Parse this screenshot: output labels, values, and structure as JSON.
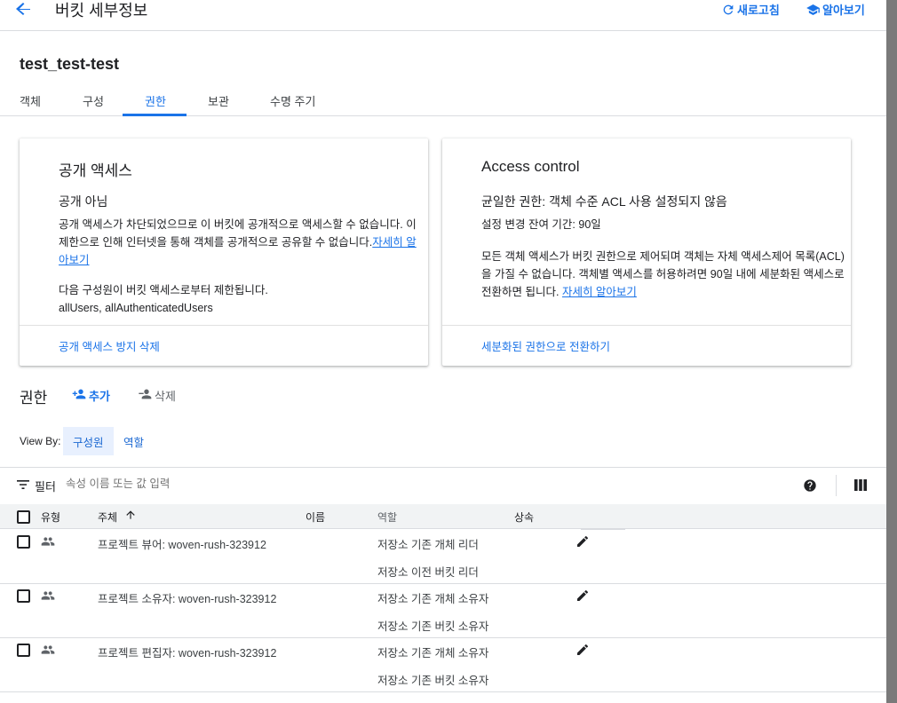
{
  "header": {
    "title": "버킷 세부정보",
    "refresh_label": "새로고침",
    "learn_label": "알아보기"
  },
  "bucket": {
    "name": "test_test-test"
  },
  "tabs": [
    {
      "label": "객체"
    },
    {
      "label": "구성"
    },
    {
      "label": "권한",
      "active": true
    },
    {
      "label": "보관"
    },
    {
      "label": "수명 주기"
    }
  ],
  "public_access_card": {
    "title": "공개 액세스",
    "status": "공개 아님",
    "description_part1": "공개 액세스가 차단되었으므로 이 버킷에 공개적으로 액세스할 수 없습니다. 이",
    "description_part2": "제한으로 인해 인터넷을 통해 객체를 공개적으로 공유할 수 없습니다.",
    "learn_more_part1": "자세히 알",
    "learn_more_part2": "아보기",
    "restricted_label": "다음 구성원이 버킷 액세스로부터 제한됩니다.",
    "restricted_members": "allUsers, allAuthenticatedUsers",
    "action": "공개 액세스 방지 삭제"
  },
  "access_control_card": {
    "title": "Access control",
    "status": "균일한 권한: 객체 수준 ACL 사용 설정되지 않음",
    "remaining": "설정 변경 잔여 기간: 90일",
    "description_line1": "모든 객체 액세스가 버킷 권한으로 제어되며 객체는 자체 액세스제어 목록(ACL)",
    "description_line2": "을 가질 수 없습니다. 객체별 액세스를 허용하려면 90일 내에 세분화된 액세스로",
    "description_line3": "전환하면 됩니다.",
    "learn_more": "자세히 알아보기",
    "action": "세분화된 권한으로 전환하기"
  },
  "permissions": {
    "title": "권한",
    "add_label": "추가",
    "delete_label": "삭제",
    "view_by_label": "View By:",
    "view_by_options": [
      {
        "label": "구성원",
        "active": true
      },
      {
        "label": "역할",
        "active": false
      }
    ],
    "filter_label": "필터",
    "filter_placeholder": "속성 이름 또는 값 입력",
    "columns": {
      "type": "유형",
      "principal": "주체",
      "name": "이름",
      "role": "역할",
      "inheritance": "상속"
    },
    "rows": [
      {
        "principal": "프로젝트 뷰어: woven-rush-323912",
        "roles": [
          "저장소 기존 개체 리더",
          "저장소 이전 버킷 리더"
        ]
      },
      {
        "principal": "프로젝트 소유자: woven-rush-323912",
        "roles": [
          "저장소 기존 개체 소유자",
          "저장소 기존 버킷 소유자"
        ]
      },
      {
        "principal": "프로젝트 편집자: woven-rush-323912",
        "roles": [
          "저장소 기존 개체 소유자",
          "저장소 기존 버킷 소유자"
        ]
      }
    ]
  },
  "colors": {
    "accent": "#1a73e8",
    "chip_bg": "#e8f0fe",
    "divider": "#dadce0"
  }
}
